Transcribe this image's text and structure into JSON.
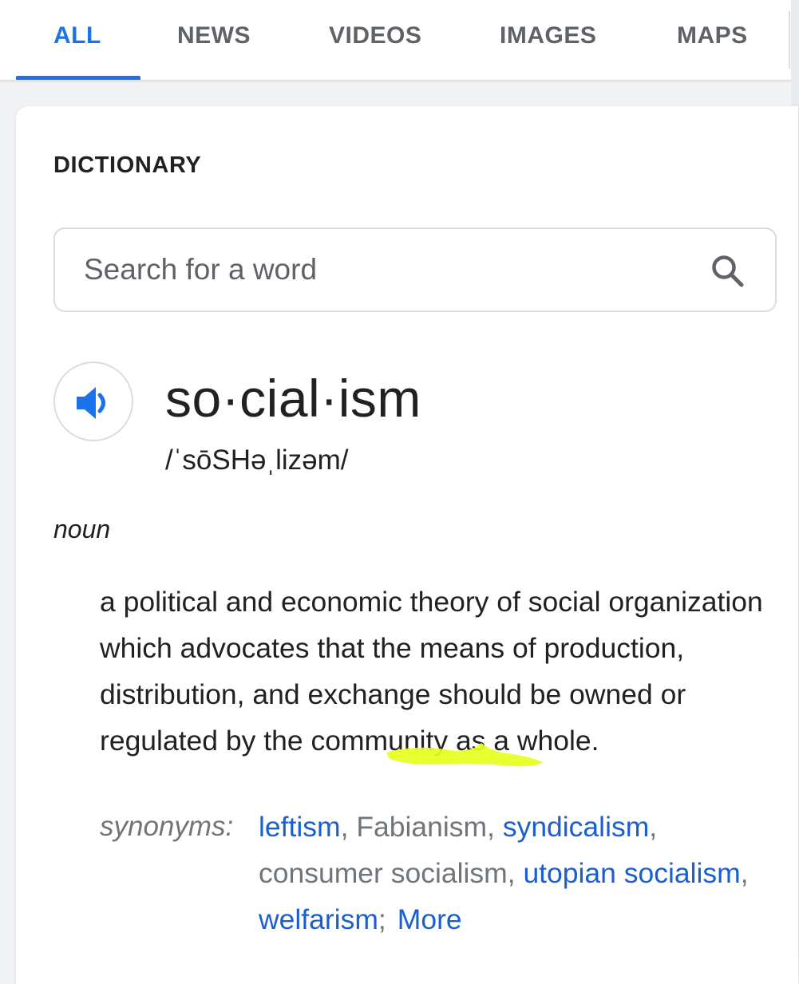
{
  "tabs": [
    {
      "label": "ALL",
      "active": true
    },
    {
      "label": "NEWS",
      "active": false
    },
    {
      "label": "VIDEOS",
      "active": false
    },
    {
      "label": "IMAGES",
      "active": false
    },
    {
      "label": "MAPS",
      "active": false
    }
  ],
  "dictionary": {
    "section_title": "DICTIONARY",
    "search_placeholder": "Search for a word",
    "headword": "so·cial·ism",
    "phonetic": "/ˈsōSHəˌlizəm/",
    "part_of_speech": "noun",
    "definition": "a political and economic theory of social organization which advocates that the means of production, distribution, and exchange should be owned or regulated by the community as a whole.",
    "synonyms_label": "synonyms:",
    "synonyms": [
      {
        "text": "leftism",
        "link": true,
        "sep": ", "
      },
      {
        "text": "Fabianism",
        "link": false,
        "sep": ", "
      },
      {
        "text": "syndicalism",
        "link": true,
        "sep": ", "
      },
      {
        "text": "consumer socialism",
        "link": false,
        "sep": ", "
      },
      {
        "text": "utopian socialism",
        "link": true,
        "sep": ", "
      },
      {
        "text": "welfarism",
        "link": true,
        "sep": ";"
      }
    ],
    "more_label": "More"
  },
  "colors": {
    "accent": "#1a73e8",
    "link": "#1a5fd0",
    "highlight": "#e6ff1e"
  },
  "icons": {
    "search": "search-icon",
    "speaker": "speaker-icon"
  }
}
